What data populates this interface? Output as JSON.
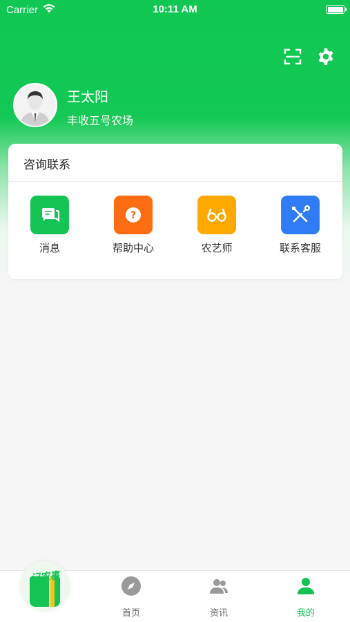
{
  "status_bar": {
    "carrier": "Carrier",
    "time": "10:11 AM"
  },
  "header": {
    "icons": [
      "scan-icon",
      "gear-icon"
    ]
  },
  "profile": {
    "name": "王太阳",
    "farm": "丰收五号农场"
  },
  "consult": {
    "title": "咨询联系",
    "items": [
      {
        "label": "消息",
        "icon": "chat-icon",
        "color": "#13c354"
      },
      {
        "label": "帮助中心",
        "icon": "help-icon",
        "color": "#ff6d12"
      },
      {
        "label": "农艺师",
        "icon": "glasses-icon",
        "color": "#ffa900"
      },
      {
        "label": "联系客服",
        "icon": "tools-icon",
        "color": "#2f7cf6"
      }
    ]
  },
  "tabbar": {
    "record_label": "记农事",
    "tabs": [
      {
        "label": "首页",
        "icon": "compass-icon",
        "active": false
      },
      {
        "label": "资讯",
        "icon": "people-icon",
        "active": false
      },
      {
        "label": "我的",
        "icon": "user-icon",
        "active": true
      }
    ]
  },
  "colors": {
    "brand_green": "#13c354",
    "inactive_gray": "#999999"
  }
}
